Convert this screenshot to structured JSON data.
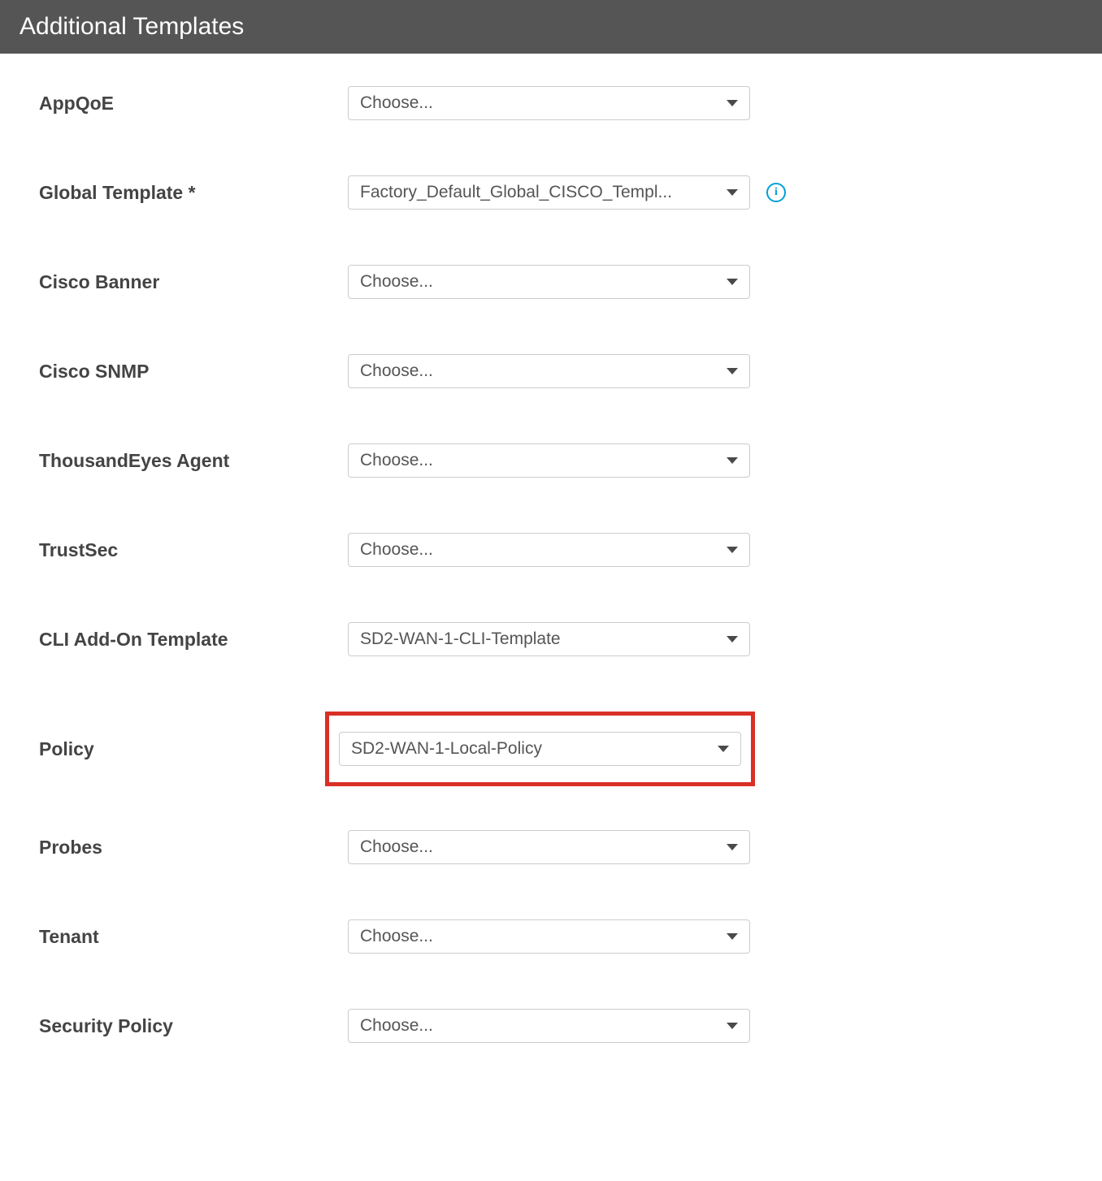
{
  "header": {
    "title": "Additional Templates"
  },
  "fields": {
    "appqoe": {
      "label": "AppQoE",
      "value": "Choose..."
    },
    "global_template": {
      "label": "Global Template *",
      "value": "Factory_Default_Global_CISCO_Templ..."
    },
    "cisco_banner": {
      "label": "Cisco Banner",
      "value": "Choose..."
    },
    "cisco_snmp": {
      "label": "Cisco SNMP",
      "value": "Choose..."
    },
    "thousandeyes": {
      "label": "ThousandEyes Agent",
      "value": "Choose..."
    },
    "trustsec": {
      "label": "TrustSec",
      "value": "Choose..."
    },
    "cli_addon": {
      "label": "CLI Add-On Template",
      "value": "SD2-WAN-1-CLI-Template"
    },
    "policy": {
      "label": "Policy",
      "value": "SD2-WAN-1-Local-Policy"
    },
    "probes": {
      "label": "Probes",
      "value": "Choose..."
    },
    "tenant": {
      "label": "Tenant",
      "value": "Choose..."
    },
    "security_policy": {
      "label": "Security Policy",
      "value": "Choose..."
    }
  }
}
